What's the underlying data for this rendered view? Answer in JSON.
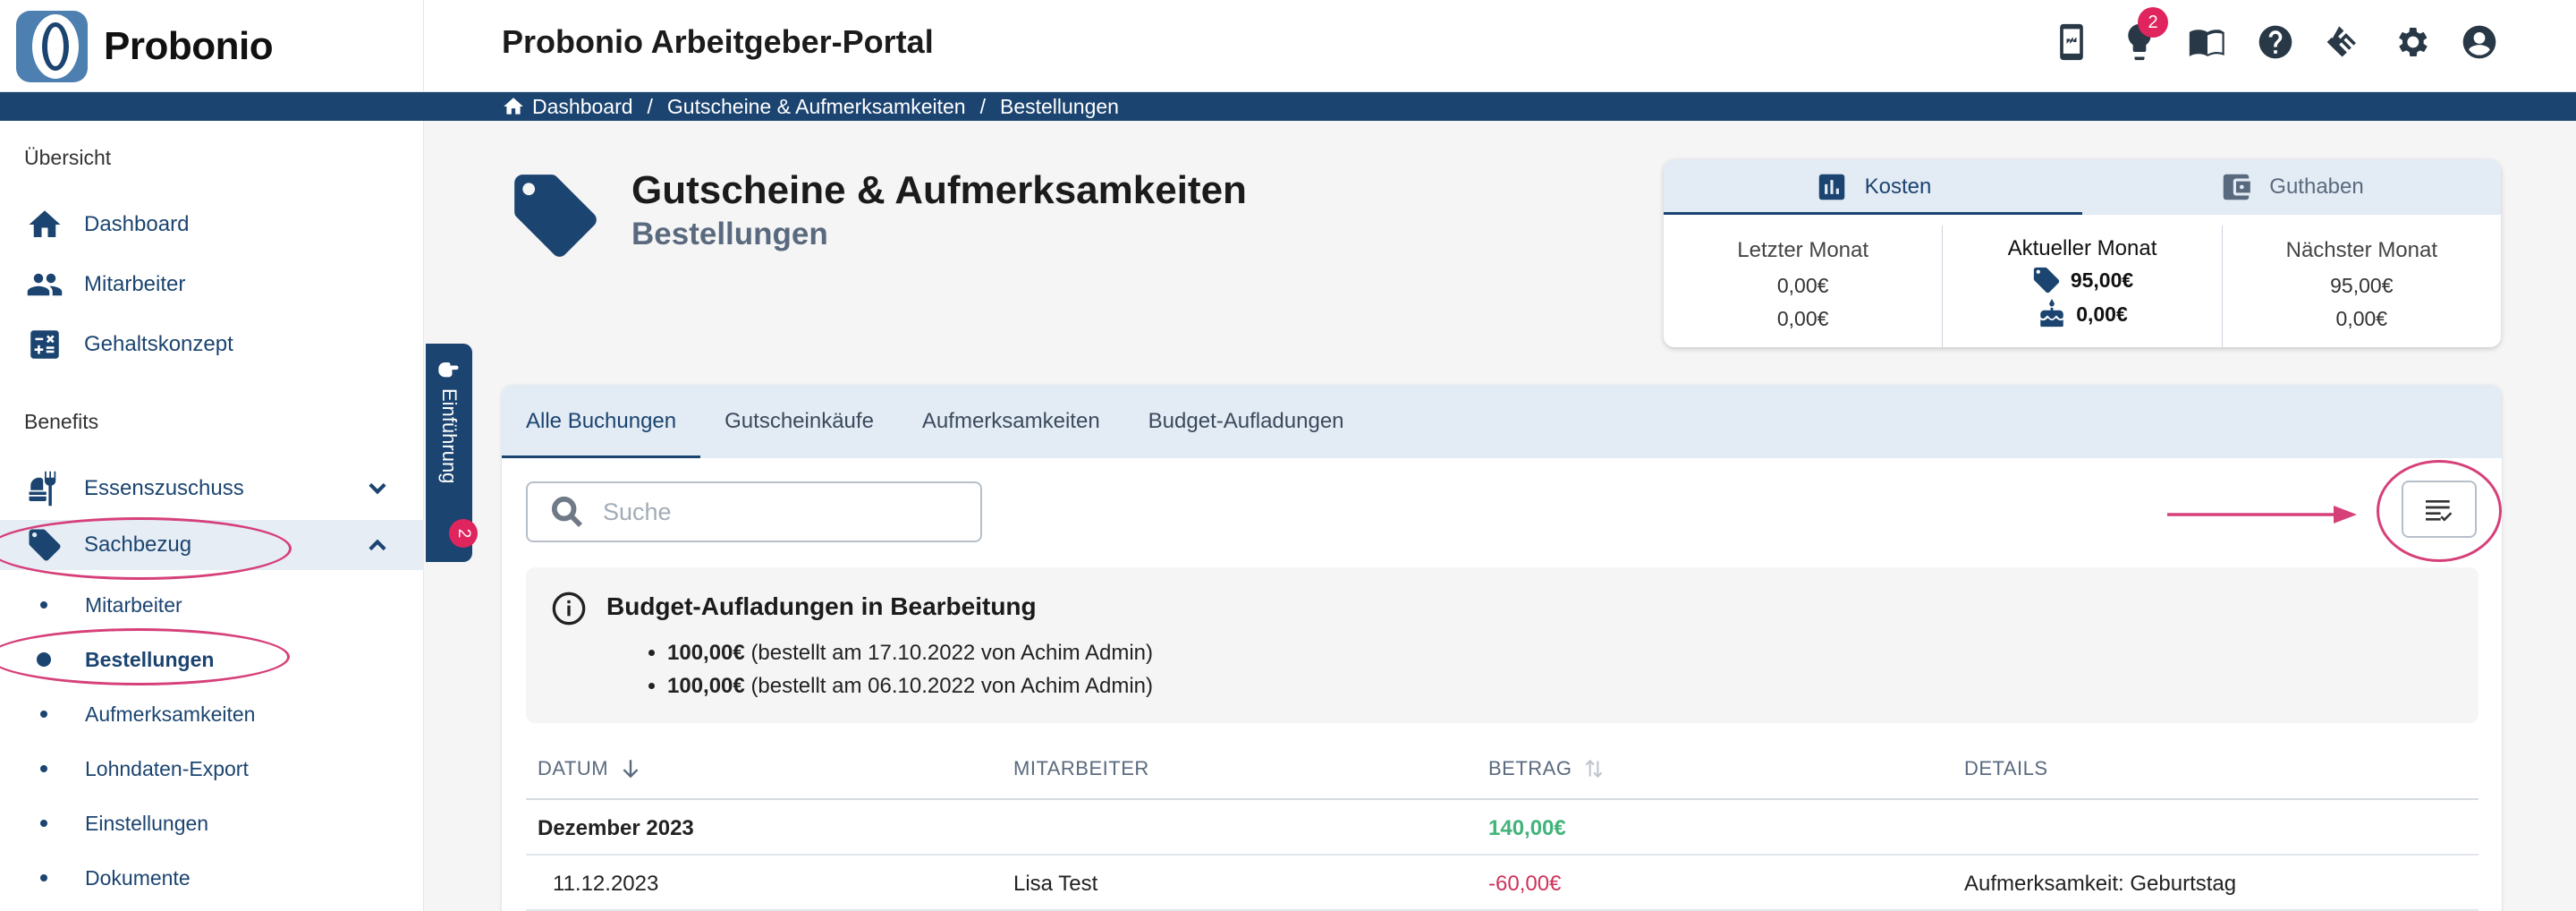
{
  "app": {
    "brand": "Probonio",
    "portal_title": "Probonio Arbeitgeber-Portal",
    "notification_count": "2"
  },
  "header_icons": [
    "mobile-app-icon",
    "lightbulb-icon",
    "book-icon",
    "help-icon",
    "handshake-icon",
    "gear-icon",
    "account-icon"
  ],
  "breadcrumb": [
    "Dashboard",
    "Gutscheine & Aufmerksamkeiten",
    "Bestellungen"
  ],
  "sidebar": {
    "overview_title": "Übersicht",
    "overview_items": [
      "Dashboard",
      "Mitarbeiter",
      "Gehaltskonzept"
    ],
    "benefits_title": "Benefits",
    "benefit_items": [
      "Essenszuschuss",
      "Sachbezug"
    ],
    "sub_items": [
      "Mitarbeiter",
      "Bestellungen",
      "Aufmerksamkeiten",
      "Lohndaten-Export",
      "Einstellungen",
      "Dokumente"
    ]
  },
  "intro": {
    "label": "Einführung",
    "badge": "2"
  },
  "page": {
    "title": "Gutscheine & Aufmerksamkeiten",
    "subtitle": "Bestellungen"
  },
  "costs": {
    "tabs": [
      "Kosten",
      "Guthaben"
    ],
    "last_month": {
      "label": "Letzter Monat",
      "values": [
        "0,00€",
        "0,00€"
      ]
    },
    "current_month": {
      "label": "Aktueller Monat",
      "values": [
        "95,00€",
        "0,00€"
      ]
    },
    "next_month": {
      "label": "Nächster Monat",
      "values": [
        "95,00€",
        "0,00€"
      ]
    }
  },
  "tabs": [
    "Alle Buchungen",
    "Gutscheinkäufe",
    "Aufmerksamkeiten",
    "Budget-Aufladungen"
  ],
  "search": {
    "placeholder": "Suche"
  },
  "info": {
    "title": "Budget-Aufladungen in Bearbeitung",
    "items": [
      {
        "amount": "100,00€",
        "text": "(bestellt am 17.10.2022 von Achim Admin)"
      },
      {
        "amount": "100,00€",
        "text": "(bestellt am 06.10.2022 von Achim Admin)"
      }
    ]
  },
  "table": {
    "headers": [
      "DATUM",
      "MITARBEITER",
      "BETRAG",
      "DETAILS"
    ],
    "group": {
      "label": "Dezember 2023",
      "amount": "140,00€"
    },
    "rows": [
      {
        "date": "11.12.2023",
        "employee": "Lisa Test",
        "amount": "-60,00€",
        "details": "Aufmerksamkeit: Geburtstag"
      }
    ]
  },
  "colors": {
    "primary": "#1b4470",
    "badge": "#e0245e",
    "annotation": "#d6407a",
    "positive": "#40b47a",
    "negative": "#d0325b"
  }
}
